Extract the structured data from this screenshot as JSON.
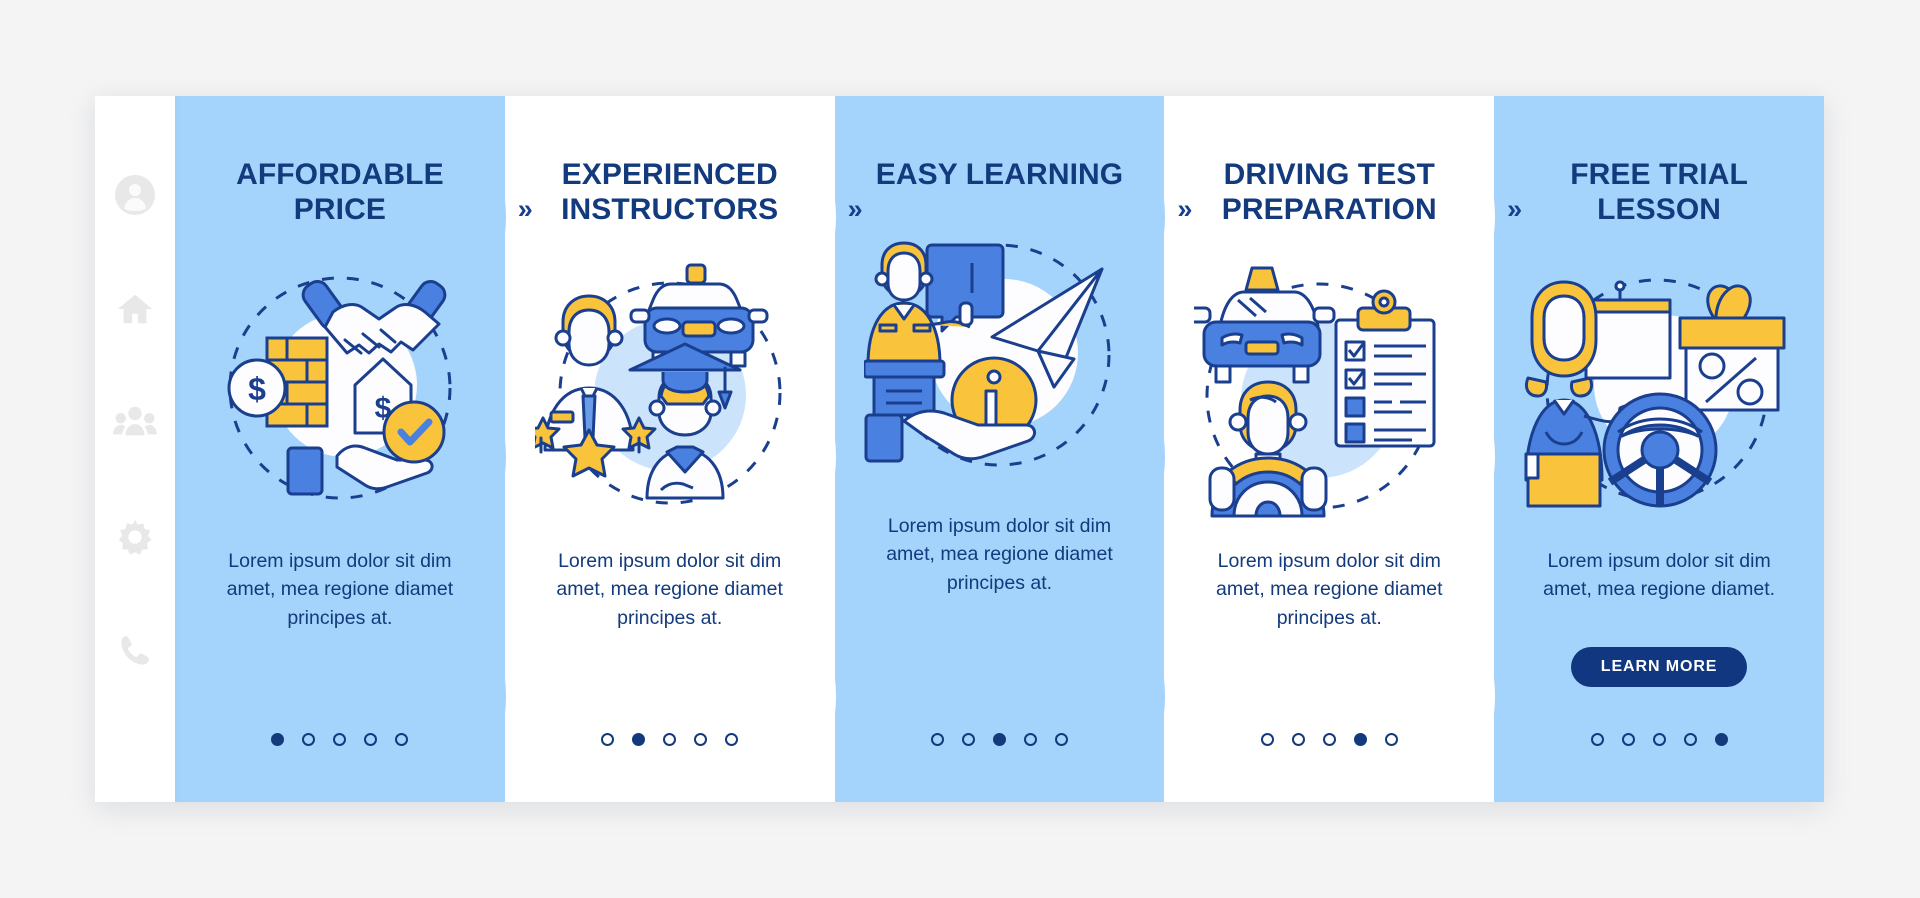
{
  "theme": {
    "page_bg": "#f4f4f4",
    "card_blue": "#a4d4fb",
    "card_white": "#ffffff",
    "title_navy": "#123a7d",
    "accent_blue": "#4a80e0",
    "accent_yellow": "#f9c33c",
    "button_navy": "#10377f",
    "sidebar_icon_gray": "#e6e6e6"
  },
  "sidebar": {
    "items": [
      {
        "icon": "user-avatar-icon",
        "label": "Profile"
      },
      {
        "icon": "home-icon",
        "label": "Home"
      },
      {
        "icon": "people-group-icon",
        "label": "Community"
      },
      {
        "icon": "gear-icon",
        "label": "Settings"
      },
      {
        "icon": "phone-icon",
        "label": "Contact"
      }
    ]
  },
  "separator": {
    "chevron": "»"
  },
  "cards": [
    {
      "title": "AFFORDABLE PRICE",
      "body": "Lorem ipsum dolor sit dim amet, mea regione diamet principes at.",
      "illustration": "handshake-money-illustration",
      "bg": "blue",
      "active_dot": 1,
      "dot_count": 5,
      "has_button": false,
      "button_label": ""
    },
    {
      "title": "EXPERIENCED INSTRUCTORS",
      "body": "Lorem ipsum dolor sit dim amet, mea regione diamet principes at.",
      "illustration": "instructor-graduate-car-illustration",
      "bg": "white",
      "active_dot": 2,
      "dot_count": 5,
      "has_button": false,
      "button_label": ""
    },
    {
      "title": "EASY LEARNING",
      "body": "Lorem ipsum dolor sit dim amet, mea regione diamet principes at.",
      "illustration": "teacher-info-paperplane-illustration",
      "bg": "blue",
      "active_dot": 3,
      "dot_count": 5,
      "has_button": false,
      "button_label": ""
    },
    {
      "title": "DRIVING TEST PREPARATION",
      "body": "Lorem ipsum dolor sit dim amet, mea regione diamet principes at.",
      "illustration": "car-driver-checklist-illustration",
      "bg": "white",
      "active_dot": 4,
      "dot_count": 5,
      "has_button": false,
      "button_label": ""
    },
    {
      "title": "FREE TRIAL LESSON",
      "body": "Lorem ipsum dolor sit dim amet, mea regione diamet.",
      "illustration": "teacher-gift-steeringwheel-illustration",
      "bg": "blue",
      "active_dot": 5,
      "dot_count": 5,
      "has_button": true,
      "button_label": "LEARN MORE"
    }
  ]
}
